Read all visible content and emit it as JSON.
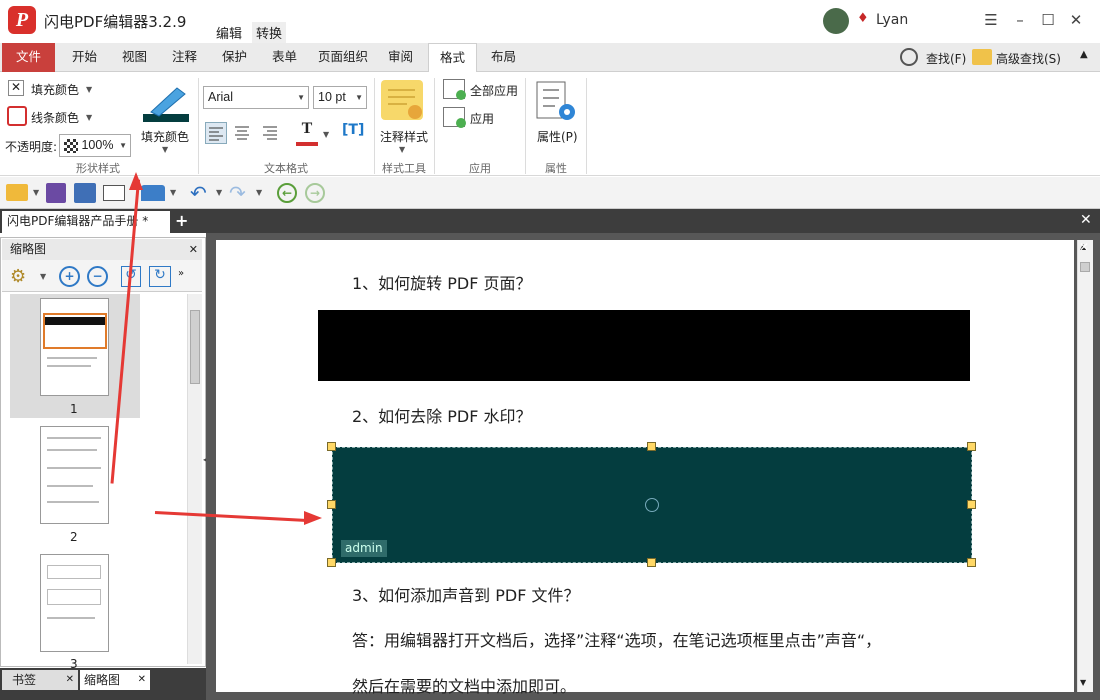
{
  "app": {
    "title": "闪电PDF编辑器3.2.9",
    "modes": [
      "编辑",
      "转换"
    ],
    "user": "Lyan"
  },
  "menu_tabs": [
    "文件",
    "开始",
    "视图",
    "注释",
    "保护",
    "表单",
    "页面组织",
    "审阅",
    "格式",
    "布局"
  ],
  "search": {
    "find": "查找(F)",
    "advanced": "高级查找(S)"
  },
  "ribbon": {
    "shape_style": {
      "fill_color": "填充颜色",
      "line_color": "线条颜色",
      "opacity_label": "不透明度:",
      "opacity_value": "100%",
      "big_fill": "填充颜色",
      "group": "形状样式"
    },
    "text_format": {
      "font": "Arial",
      "size": "10 pt",
      "group": "文本格式"
    },
    "style_tools": {
      "annot_style": "注释样式",
      "group": "样式工具"
    },
    "apply": {
      "apply_all": "全部应用",
      "apply": "应用",
      "group": "应用"
    },
    "properties": {
      "label": "属性(P)",
      "group": "属性"
    }
  },
  "document_tab": "闪电PDF编辑器产品手册 *",
  "panel": {
    "title": "缩略图",
    "pages": [
      "1",
      "2",
      "3"
    ],
    "bottom_tabs": [
      "书签",
      "缩略图"
    ]
  },
  "page": {
    "q1": "1、如何旋转 PDF 页面？",
    "q2": "2、如何去除 PDF 水印？",
    "q3": "3、如何添加声音到 PDF 文件？",
    "a3_line1": "答：用编辑器打开文档后，选择”注释“选项，在笔记选项框里点击”声音“，",
    "a3_line2": "然后在需要的文档中添加即可。",
    "annotation_author": "admin"
  },
  "colors": {
    "accent": "#c9403c",
    "fill": "#043d3f",
    "arrow": "#e53935"
  }
}
